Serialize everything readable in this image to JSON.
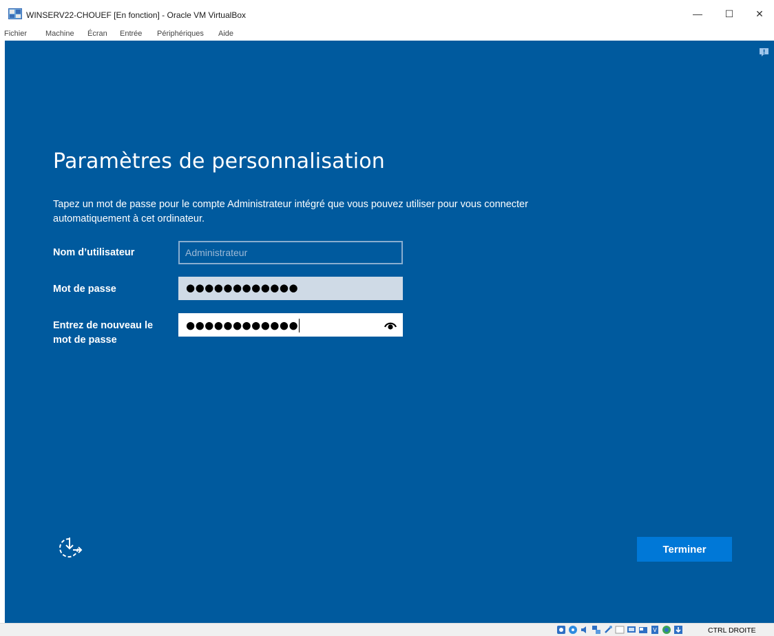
{
  "window": {
    "title": "WINSERV22-CHOUEF [En fonction] - Oracle VM VirtualBox",
    "minimize_label": "—",
    "maximize_label": "☐",
    "close_label": "✕"
  },
  "menu": {
    "items": [
      "Fichier",
      "Machine",
      "Écran",
      "Entrée",
      "Périphériques",
      "Aide"
    ]
  },
  "setup": {
    "heading": "Paramètres de personnalisation",
    "description": "Tapez un mot de passe pour le compte Administrateur intégré que vous pouvez utiliser pour vous connecter automatiquement à cet ordinateur.",
    "username_label": "Nom d’utilisateur",
    "username_value": "Administrateur",
    "password_label": "Mot de passe",
    "password_mask": "●●●●●●●●●●●●",
    "confirm_label": "Entrez de nouveau le mot de passe",
    "confirm_mask": "●●●●●●●●●●●●",
    "finish_label": "Terminer"
  },
  "statusbar": {
    "host_key": "CTRL DROITE",
    "icons": [
      "harddisk-icon",
      "optical-drive-icon",
      "audio-icon",
      "network-icon",
      "usb-icon",
      "shared-folder-icon",
      "display-icon",
      "video-capture-icon",
      "cpu-icon",
      "guest-additions-icon",
      "keyboard-capture-icon"
    ]
  },
  "colors": {
    "vm_background": "#005a9e",
    "button_accent": "#0078d7"
  }
}
